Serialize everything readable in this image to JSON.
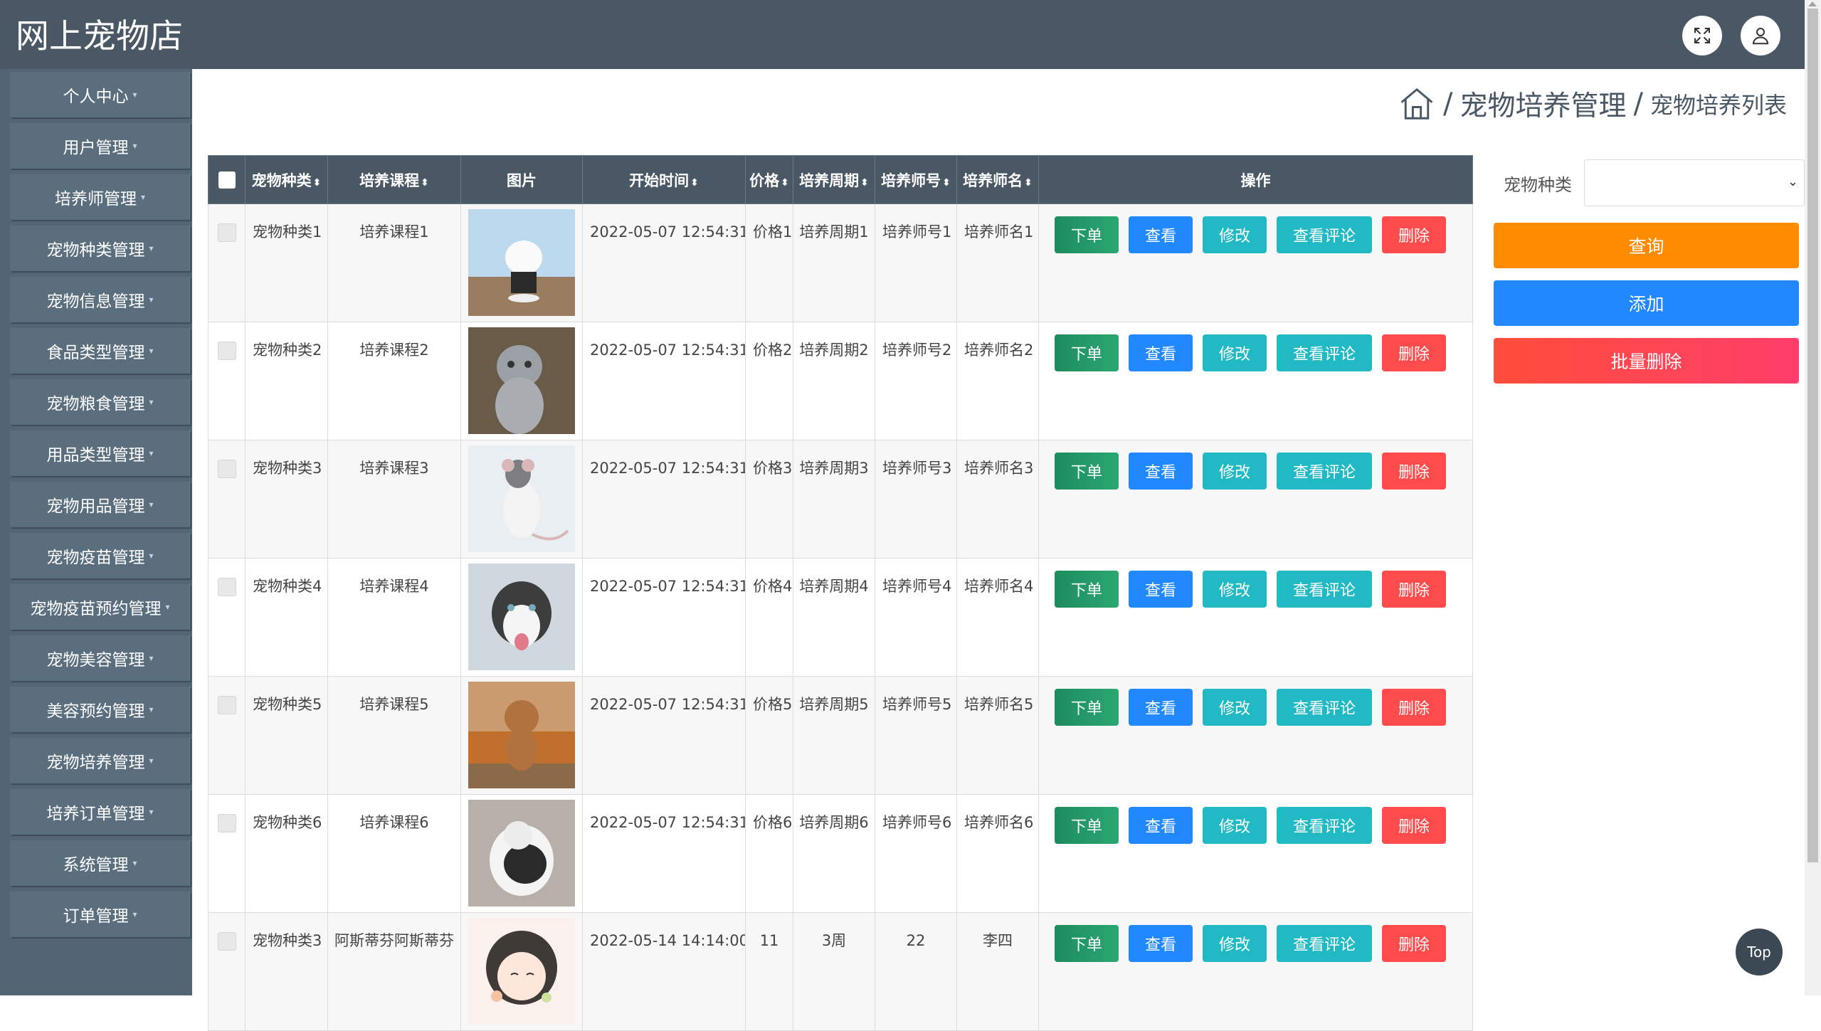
{
  "app": {
    "title": "网上宠物店"
  },
  "icons": {
    "fullscreen": "fullscreen-icon",
    "user": "user-icon",
    "home": "home-icon"
  },
  "sidebar": {
    "items": [
      {
        "label": "个人中心"
      },
      {
        "label": "用户管理"
      },
      {
        "label": "培养师管理"
      },
      {
        "label": "宠物种类管理"
      },
      {
        "label": "宠物信息管理"
      },
      {
        "label": "食品类型管理"
      },
      {
        "label": "宠物粮食管理"
      },
      {
        "label": "用品类型管理"
      },
      {
        "label": "宠物用品管理"
      },
      {
        "label": "宠物疫苗管理"
      },
      {
        "label": "宠物疫苗预约管理"
      },
      {
        "label": "宠物美容管理"
      },
      {
        "label": "美容预约管理"
      },
      {
        "label": "宠物培养管理"
      },
      {
        "label": "培养订单管理"
      },
      {
        "label": "系统管理"
      },
      {
        "label": "订单管理"
      }
    ]
  },
  "breadcrumb": {
    "sep": "/",
    "level1": "宠物培养管理",
    "level2": "宠物培养列表"
  },
  "filter": {
    "label": "宠物种类",
    "value": ""
  },
  "actions": {
    "query": "查询",
    "add": "添加",
    "batch_delete": "批量删除"
  },
  "table": {
    "headers": {
      "species": "宠物种类",
      "course": "培养课程",
      "image": "图片",
      "start_time": "开始时间",
      "price": "价格",
      "period": "培养周期",
      "trainer_no": "培养师号",
      "trainer_name": "培养师名",
      "ops": "操作"
    },
    "sort_mark": "⬍",
    "row_buttons": {
      "order": "下单",
      "view": "查看",
      "edit": "修改",
      "review": "查看评论",
      "delete": "删除"
    },
    "rows": [
      {
        "species": "宠物种类1",
        "course": "培养课程1",
        "image": "white-dog-photo",
        "start_time": "2022-05-07 12:54:31",
        "price": "价格1",
        "period": "培养周期1",
        "trainer_no": "培养师号1",
        "trainer_name": "培养师名1"
      },
      {
        "species": "宠物种类2",
        "course": "培养课程2",
        "image": "kitten-photo",
        "start_time": "2022-05-07 12:54:31",
        "price": "价格2",
        "period": "培养周期2",
        "trainer_no": "培养师号2",
        "trainer_name": "培养师名2"
      },
      {
        "species": "宠物种类3",
        "course": "培养课程3",
        "image": "rat-photo",
        "start_time": "2022-05-07 12:54:31",
        "price": "价格3",
        "period": "培养周期3",
        "trainer_no": "培养师号3",
        "trainer_name": "培养师名3"
      },
      {
        "species": "宠物种类4",
        "course": "培养课程4",
        "image": "husky-photo",
        "start_time": "2022-05-07 12:54:31",
        "price": "价格4",
        "period": "培养周期4",
        "trainer_no": "培养师号4",
        "trainer_name": "培养师名4"
      },
      {
        "species": "宠物种类5",
        "course": "培养课程5",
        "image": "poodle-photo",
        "start_time": "2022-05-07 12:54:31",
        "price": "价格5",
        "period": "培养周期5",
        "trainer_no": "培养师号5",
        "trainer_name": "培养师名5"
      },
      {
        "species": "宠物种类6",
        "course": "培养课程6",
        "image": "sheepdog-photo",
        "start_time": "2022-05-07 12:54:31",
        "price": "价格6",
        "period": "培养周期6",
        "trainer_no": "培养师号6",
        "trainer_name": "培养师名6"
      },
      {
        "species": "宠物种类3",
        "course": "阿斯蒂芬阿斯蒂芬",
        "image": "cartoon-girl-image",
        "start_time": "2022-05-14 14:14:00",
        "price": "11",
        "period": "3周",
        "trainer_no": "22",
        "trainer_name": "李四"
      }
    ]
  },
  "back_to_top": "Top"
}
